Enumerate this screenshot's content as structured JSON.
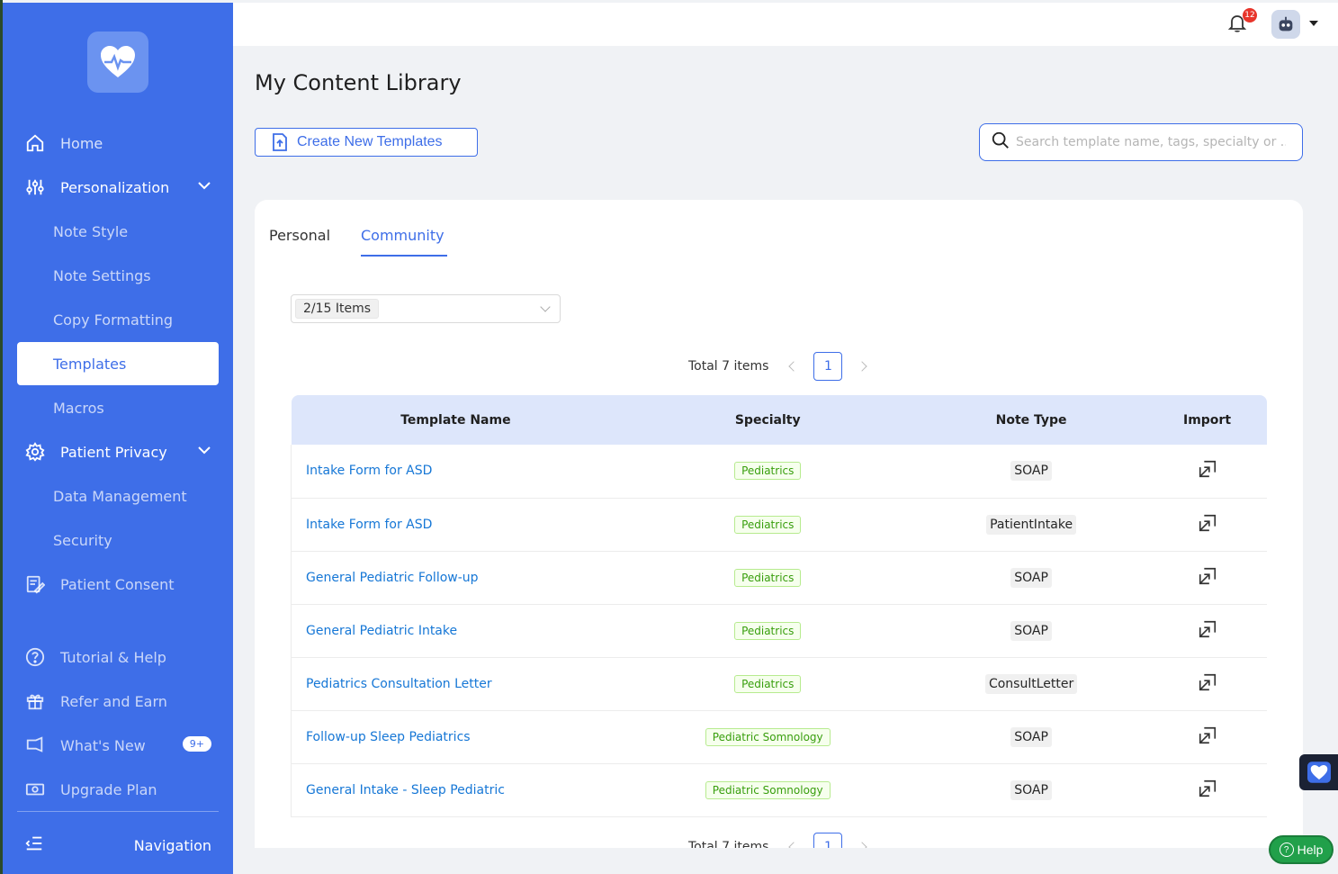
{
  "sidebar": {
    "items": [
      {
        "label": "Home"
      },
      {
        "label": "Personalization"
      },
      {
        "label": "Note Style"
      },
      {
        "label": "Note Settings"
      },
      {
        "label": "Copy Formatting"
      },
      {
        "label": "Templates"
      },
      {
        "label": "Macros"
      },
      {
        "label": "Patient Privacy"
      },
      {
        "label": "Data Management"
      },
      {
        "label": "Security"
      },
      {
        "label": "Patient Consent"
      },
      {
        "label": "Tutorial & Help"
      },
      {
        "label": "Refer and Earn"
      },
      {
        "label": "What's New",
        "badge": "9+"
      },
      {
        "label": "Upgrade Plan"
      }
    ],
    "bottom_label": "Navigation"
  },
  "topbar": {
    "notification_count": "12"
  },
  "page": {
    "title": "My Content Library",
    "create_label": "Create New Templates",
    "search_placeholder": "Search template name, tags, specialty or ..."
  },
  "tabs": [
    {
      "label": "Personal"
    },
    {
      "label": "Community"
    }
  ],
  "filter": {
    "selected": "2/15 Items"
  },
  "pagination": {
    "total_text": "Total 7 items",
    "current_page": "1"
  },
  "table": {
    "headers": [
      "Template Name",
      "Specialty",
      "Note Type",
      "Import"
    ],
    "rows": [
      {
        "name": "Intake Form for ASD",
        "specialty": "Pediatrics",
        "note_type": "SOAP"
      },
      {
        "name": "Intake Form for ASD",
        "specialty": "Pediatrics",
        "note_type": "PatientIntake"
      },
      {
        "name": "General Pediatric Follow-up",
        "specialty": "Pediatrics",
        "note_type": "SOAP"
      },
      {
        "name": "General Pediatric Intake",
        "specialty": "Pediatrics",
        "note_type": "SOAP"
      },
      {
        "name": "Pediatrics Consultation Letter",
        "specialty": "Pediatrics",
        "note_type": "ConsultLetter"
      },
      {
        "name": "Follow-up Sleep Pediatrics",
        "specialty": "Pediatric Somnology",
        "note_type": "SOAP"
      },
      {
        "name": "General Intake - Sleep Pediatric",
        "specialty": "Pediatric Somnology",
        "note_type": "SOAP"
      }
    ]
  },
  "help_label": "Help",
  "colors": {
    "primary": "#3e6ee8",
    "link": "#1677d6",
    "tag_green": "#389e0d",
    "header_bg": "#dde6fb"
  }
}
